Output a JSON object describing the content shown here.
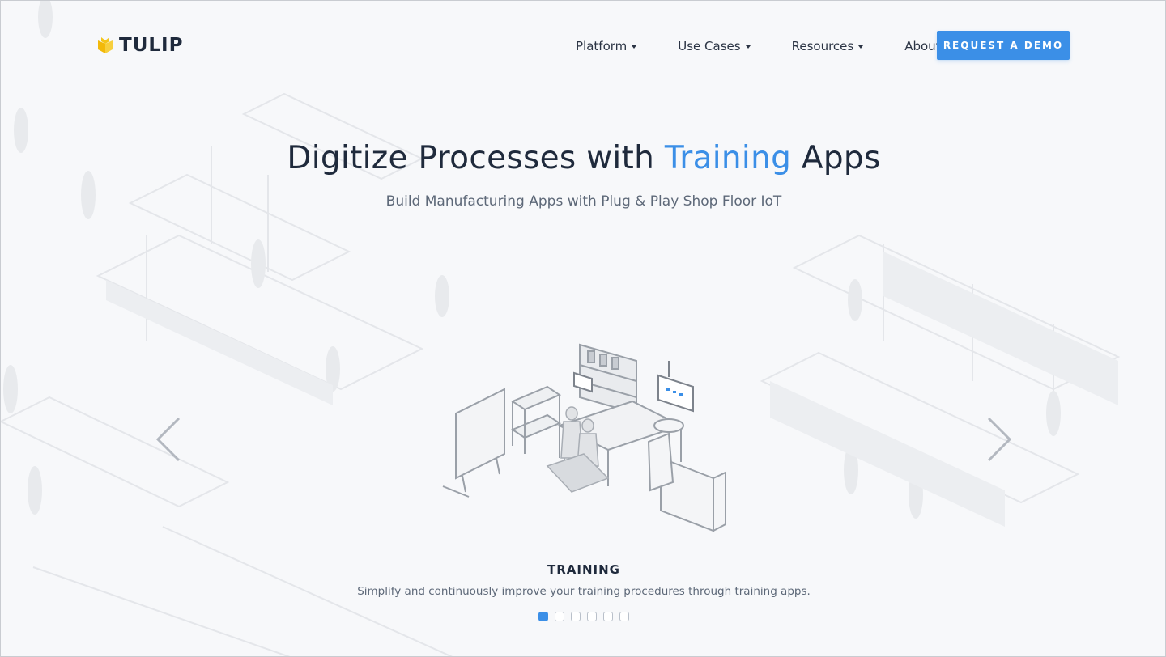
{
  "brand": {
    "name": "TULIP",
    "logo_color": "#f5c518"
  },
  "nav": {
    "items": [
      {
        "label": "Platform"
      },
      {
        "label": "Use Cases"
      },
      {
        "label": "Resources"
      },
      {
        "label": "About"
      }
    ],
    "cta_label": "REQUEST A DEMO"
  },
  "hero": {
    "title_prefix": "Digitize Processes with ",
    "title_accent": "Training",
    "title_suffix": " Apps",
    "subtitle": "Build Manufacturing Apps with Plug & Play Shop Floor IoT"
  },
  "carousel": {
    "slide_title": "TRAINING",
    "slide_description": "Simplify and continuously improve your training procedures through training apps.",
    "total_slides": 6,
    "active_index": 0
  },
  "colors": {
    "accent": "#3b8fe7",
    "text": "#1f2a3c",
    "muted": "#5d6878"
  },
  "icons": {
    "prev": "chevron-left-icon",
    "next": "chevron-right-icon",
    "dropdown": "caret-down-icon"
  }
}
